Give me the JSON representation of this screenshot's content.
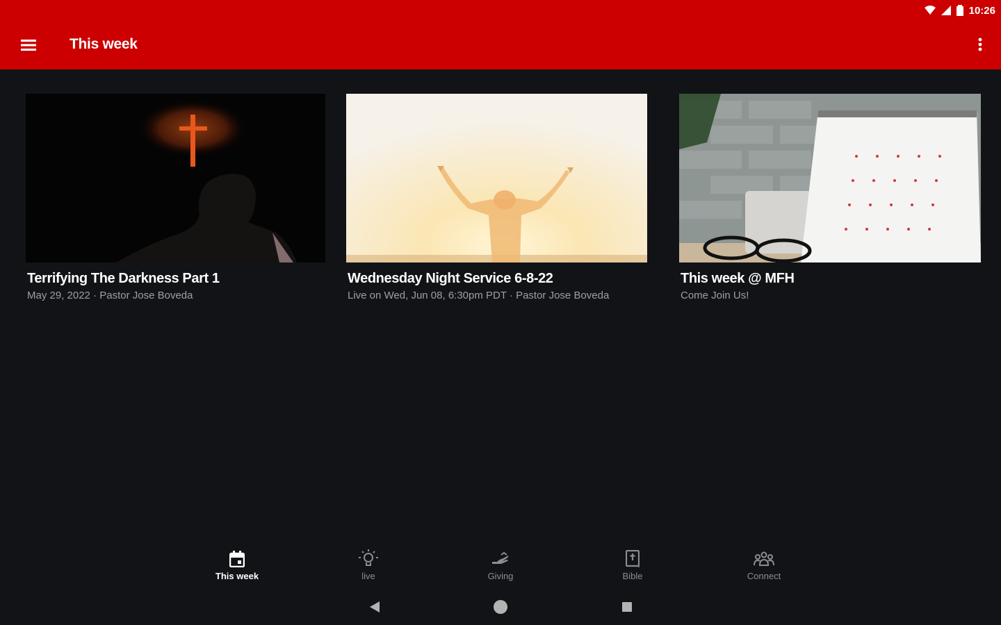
{
  "status_bar": {
    "time": "10:26"
  },
  "app_bar": {
    "title": "This week",
    "menu_icon": "hamburger-menu-icon",
    "overflow_icon": "more-vert-icon",
    "color": "#cc0000"
  },
  "cards": [
    {
      "title": "Terrifying The Darkness Part 1",
      "subtitle": "May 29, 2022 · Pastor Jose Boveda",
      "image": "cross-sunset-silhouette"
    },
    {
      "title": "Wednesday Night Service 6-8-22",
      "subtitle": "Live on Wed, Jun 08, 6:30pm PDT · Pastor Jose Boveda",
      "image": "raised-arms-sunlight"
    },
    {
      "title": "This week @ MFH",
      "subtitle": "Come Join Us!",
      "image": "desk-calendar-glasses"
    }
  ],
  "bottom_nav": [
    {
      "label": "This week",
      "icon": "calendar-icon",
      "active": true
    },
    {
      "label": "live",
      "icon": "lightbulb-icon",
      "active": false
    },
    {
      "label": "Giving",
      "icon": "giving-hand-icon",
      "active": false
    },
    {
      "label": "Bible",
      "icon": "bible-icon",
      "active": false
    },
    {
      "label": "Connect",
      "icon": "group-icon",
      "active": false
    }
  ],
  "system_nav": {
    "back_icon": "back-triangle-icon",
    "home_icon": "home-circle-icon",
    "recents_icon": "recents-square-icon"
  },
  "colors": {
    "background": "#121316",
    "secondary_text": "#9aa0a6"
  }
}
